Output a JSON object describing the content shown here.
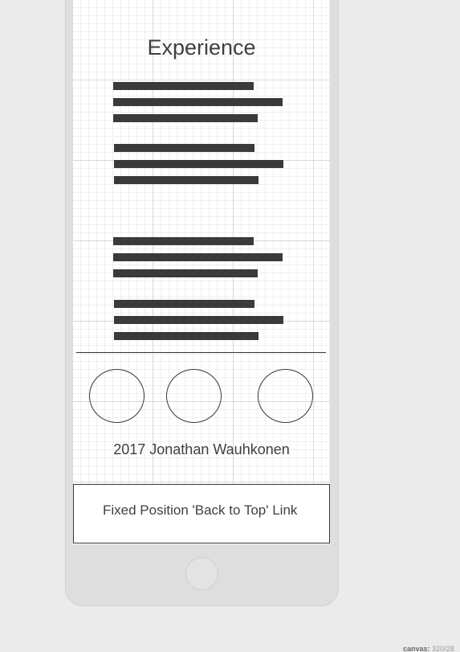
{
  "section": {
    "title": "Experience"
  },
  "text_block_count": 4,
  "social": {
    "links": [
      {
        "name": "social-link-1"
      },
      {
        "name": "social-link-2"
      },
      {
        "name": "social-link-3"
      }
    ]
  },
  "footer": {
    "copyright": "2017 Jonathan Wauhkonen"
  },
  "fixed_link": {
    "label": "Fixed Position 'Back to Top' Link"
  },
  "canvas_info": {
    "label": "canvas:",
    "value": "320/28"
  },
  "colors": {
    "placeholder_line": "#3a3a3a",
    "page_background": "#ebebeb",
    "device_frame": "#dedede"
  }
}
